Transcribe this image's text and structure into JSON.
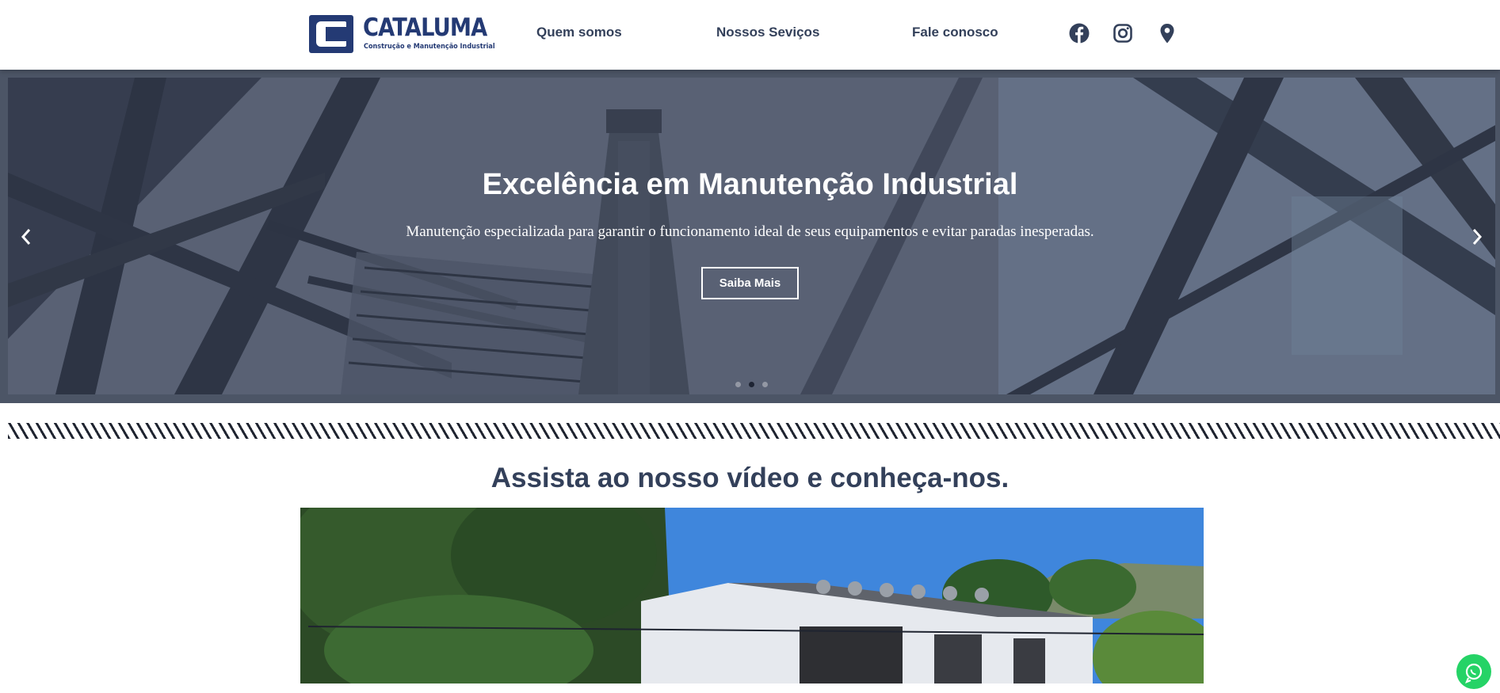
{
  "brand": {
    "name": "CATALUMA",
    "tagline": "Construção e Manutenção Industrial"
  },
  "nav": {
    "items": [
      {
        "label": "Quem somos"
      },
      {
        "label": "Nossos Seviços"
      },
      {
        "label": "Fale conosco"
      }
    ]
  },
  "social": {
    "icons": [
      "facebook-icon",
      "instagram-icon",
      "map-pin-icon"
    ]
  },
  "hero": {
    "title": "Excelência em Manutenção Industrial",
    "subtitle": "Manutenção especializada para garantir o funcionamento ideal de seus equipamentos e evitar paradas inesperadas.",
    "button_label": "Saiba Mais",
    "slide_count": 3,
    "active_slide": 2
  },
  "video_section": {
    "title": "Assista ao nosso vídeo e conheça-nos."
  },
  "colors": {
    "brand_blue": "#243a74",
    "nav_text": "#33405a",
    "whatsapp_green": "#25d366"
  }
}
